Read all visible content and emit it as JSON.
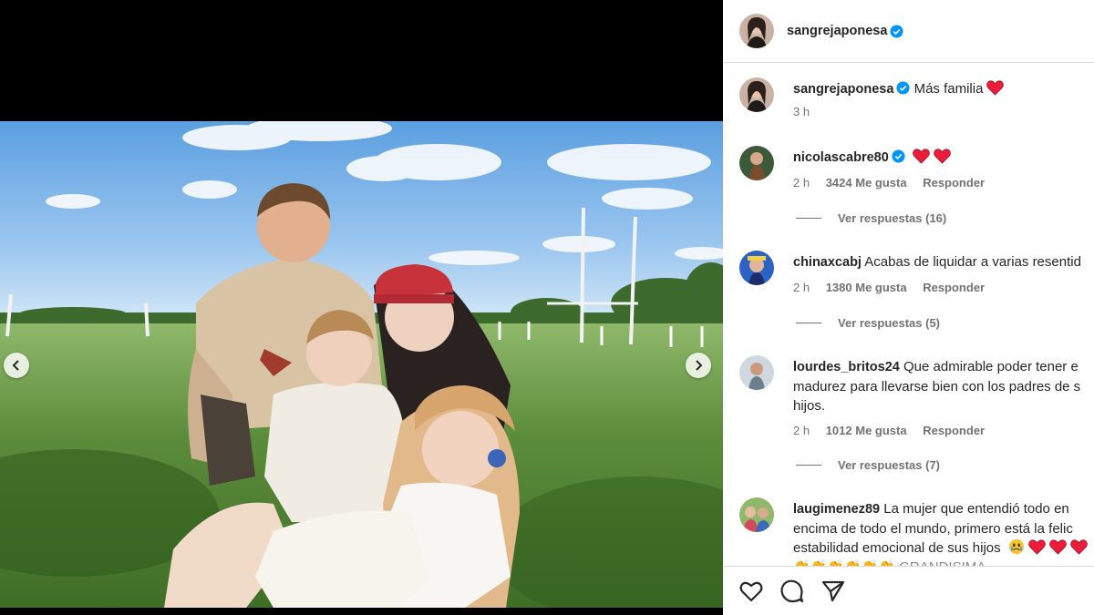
{
  "post": {
    "author": "sangrejaponesa",
    "verified": true,
    "caption": "Más familia",
    "caption_emoji": "red-heart",
    "time": "3 h"
  },
  "comments": [
    {
      "user": "nicolascabre80",
      "verified": true,
      "lines": [
        ""
      ],
      "emojis": [
        "red-heart",
        "red-heart"
      ],
      "time": "2 h",
      "likes": "3424 Me gusta",
      "reply": "Responder",
      "replies": "Ver respuestas (16)"
    },
    {
      "user": "chinaxcabj",
      "verified": false,
      "lines": [
        "Acabas de liquidar a varias resentid"
      ],
      "time": "2 h",
      "likes": "1380 Me gusta",
      "reply": "Responder",
      "replies": "Ver respuestas (5)"
    },
    {
      "user": "lourdes_britos24",
      "verified": false,
      "lines": [
        "Que admirable poder tener e",
        "madurez para llevarse bien con los padres de s",
        "hijos."
      ],
      "time": "2 h",
      "likes": "1012 Me gusta",
      "reply": "Responder",
      "replies": "Ver respuestas (7)"
    },
    {
      "user": "laugimenez89",
      "verified": false,
      "lines": [
        "La mujer que entendió todo en",
        "encima de todo el mundo, primero está la felic",
        "estabilidad emocional de sus hijos"
      ],
      "emojis": [
        "tears-face",
        "red-heart",
        "red-heart",
        "red-heart"
      ],
      "partial_line": "👏👏👏👏👏👏 GRANDISIMA"
    }
  ],
  "actions": [
    "like-icon",
    "comment-icon",
    "share-icon"
  ],
  "colors": {
    "verified": "#0095f6",
    "heart": "#ed1c3a",
    "muted": "#737373",
    "text": "#262626"
  }
}
